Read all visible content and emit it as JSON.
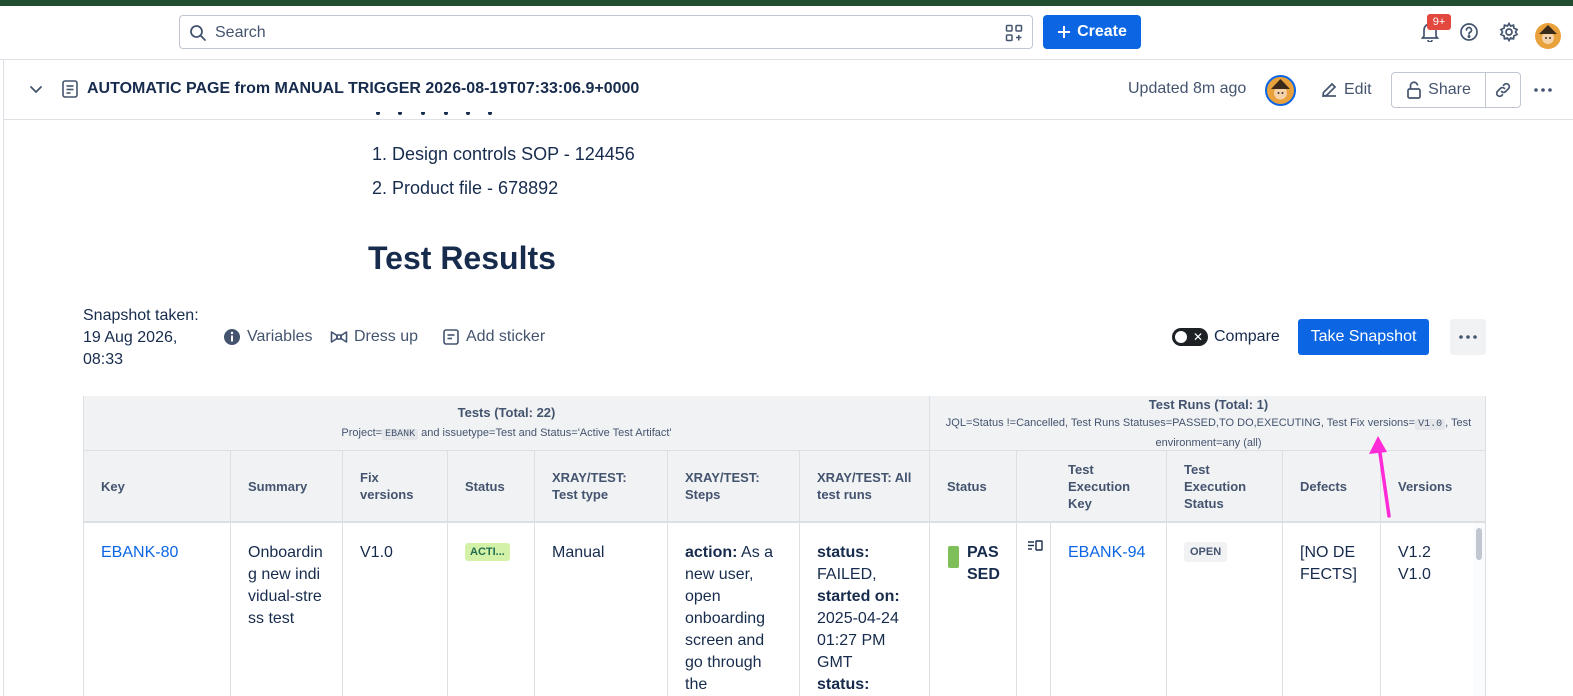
{
  "nav": {
    "search_placeholder": "Search",
    "create_label": "Create",
    "notification_count": "9+",
    "brand_color": "#0c66e4",
    "stripe_color": "#1f4d2e"
  },
  "page": {
    "title": "AUTOMATIC PAGE from MANUAL TRIGGER 2026-08-19T07:33:06.9+0000",
    "updated": "Updated 8m ago",
    "edit_label": "Edit",
    "share_label": "Share"
  },
  "content": {
    "list_items": [
      "Design controls SOP - 124456",
      "Product file - 678892"
    ],
    "section_heading": "Test Results"
  },
  "report_toolbar": {
    "snapshot_label": "Snapshot taken:\n19 Aug 2026,\n08:33",
    "variables_label": "Variables",
    "dress_up_label": "Dress up",
    "add_sticker_label": "Add sticker",
    "compare_label": "Compare",
    "take_snapshot_label": "Take Snapshot"
  },
  "report": {
    "tests_group": {
      "title": "Tests (Total: 22)",
      "query_pre": "Project=",
      "query_code": "EBANK",
      "query_post": " and issuetype=Test and Status='Active Test Artifact'"
    },
    "runs_group": {
      "title": "Test Runs (Total: 1)",
      "jql_pre": "JQL=Status !=Cancelled, Test Runs Statuses=PASSED,TO DO,EXECUTING, Test Fix versions=",
      "jql_code": "V1.0",
      "jql_post": ", Test environment=any (all)"
    },
    "columns": {
      "key": "Key",
      "summary": "Summary",
      "fix_versions": "Fix versions",
      "status": "Status",
      "test_type": "XRAY/TEST: Test type",
      "steps": "XRAY/TEST: Steps",
      "all_runs": "XRAY/TEST: All test runs",
      "run_status": "Status",
      "exec_key": "Test Execution Key",
      "exec_status": "Test Execution Status",
      "defects": "Defects",
      "versions": "Versions"
    },
    "row": {
      "key": "EBANK-80",
      "summary": "Onboarding new individual-stress test",
      "fix_versions": "V1.0",
      "status": "ACTI...",
      "test_type": "Manual",
      "steps_label": "action:",
      "steps_text": " As a new user, open onboarding screen and go through the",
      "runs_status_label": "status:",
      "runs_status_value": " FAILED,",
      "runs_started_label": "started on:",
      "runs_started_value": " 2025-04-24 01:27 PM GMT",
      "runs_status_label_2": "status:",
      "run_status": "PASSED",
      "run_status_color": "#7ebf5a",
      "exec_key": "EBANK-94",
      "exec_status": "OPEN",
      "defects": "[NO DEFECTS]",
      "versions_1": "V1.2",
      "versions_2": "V1.0"
    }
  },
  "annotation": {
    "arrow_color": "#ff2bd6"
  }
}
